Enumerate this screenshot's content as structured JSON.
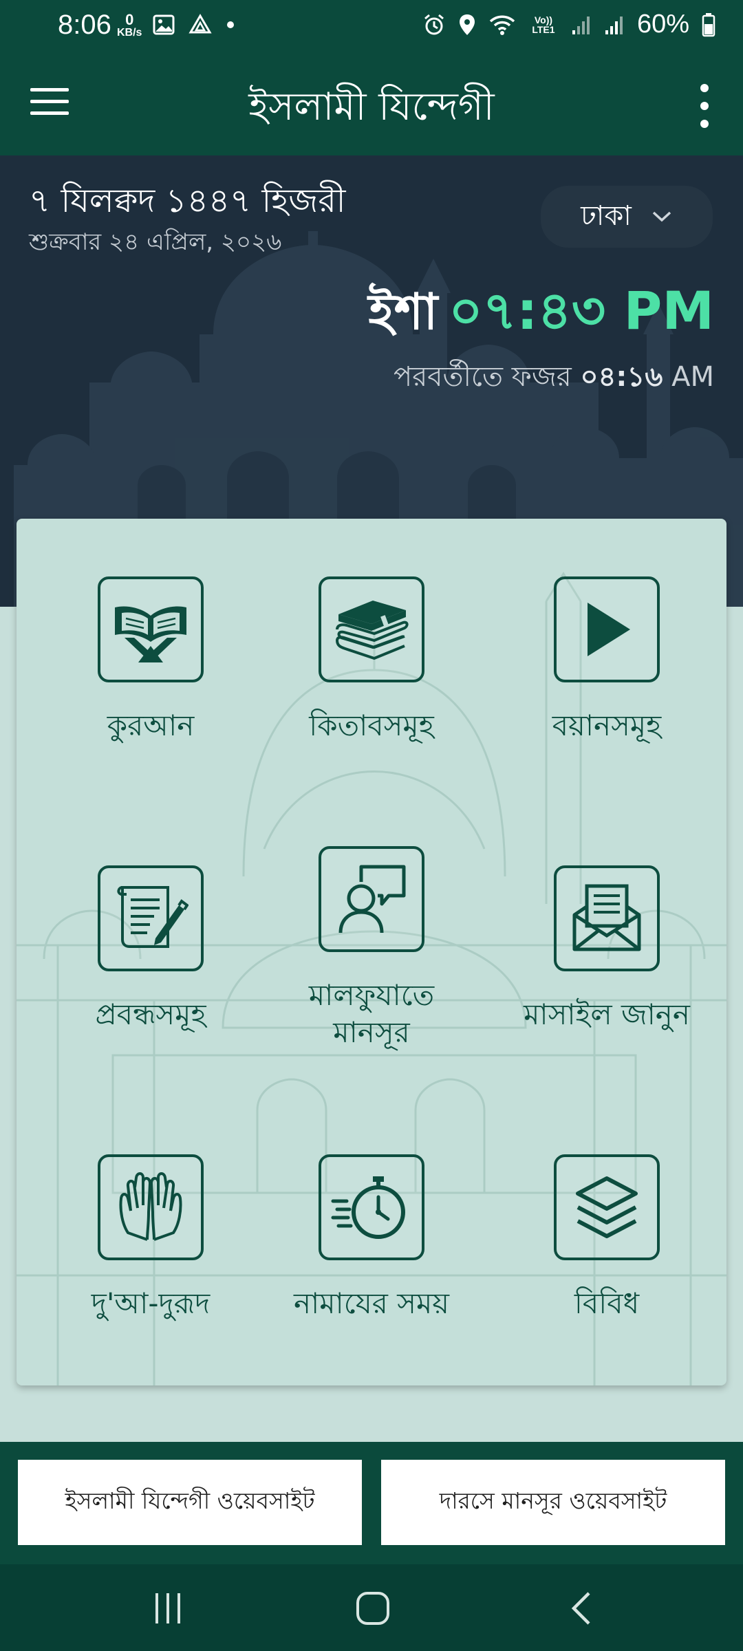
{
  "status_bar": {
    "time": "8:06",
    "data_speed_value": "0",
    "data_speed_unit": "KB/s",
    "lte_label": "Vo)) LTE1",
    "battery": "60%"
  },
  "app_bar": {
    "title": "ইসলামী যিন্দেগী"
  },
  "header": {
    "hijri_date": "৭ যিলক্বদ ১৪৪৭ হিজরী",
    "gregorian_date": "শুক্রবার ২৪ এপ্রিল, ২০২৬",
    "city": "ঢাকা",
    "current_prayer_name": "ইশা",
    "current_prayer_time": "০৭:৪৩ PM",
    "next_prayer_prefix": "পরবর্তীতে ফজর",
    "next_prayer_time": "০৪:১৬",
    "next_prayer_ampm": "AM"
  },
  "menu": {
    "items": [
      {
        "label": "কুরআন",
        "icon": "quran-icon"
      },
      {
        "label": "কিতাবসমূহ",
        "icon": "books-icon"
      },
      {
        "label": "বয়ানসমূহ",
        "icon": "play-icon"
      },
      {
        "label": "প্রবন্ধসমূহ",
        "icon": "article-icon"
      },
      {
        "label": "মালফুযাতে মানসূর",
        "icon": "speech-person-icon"
      },
      {
        "label": "মাসাইল জানুন",
        "icon": "envelope-icon"
      },
      {
        "label": "দু'আ-দুরূদ",
        "icon": "praying-hands-icon"
      },
      {
        "label": "নামাযের সময়",
        "icon": "stopwatch-icon"
      },
      {
        "label": "বিবিধ",
        "icon": "layers-icon"
      }
    ]
  },
  "footer": {
    "website1_label": "ইসলামী যিন্দেগী ওয়েবসাইট",
    "website2_label": "দারসে মানসূর ওয়েবসাইট"
  },
  "colors": {
    "primary": "#0b4a3c",
    "accent": "#4de0a6",
    "card_bg": "#c4dfd9",
    "hero_bg": "#1e2e3d"
  }
}
